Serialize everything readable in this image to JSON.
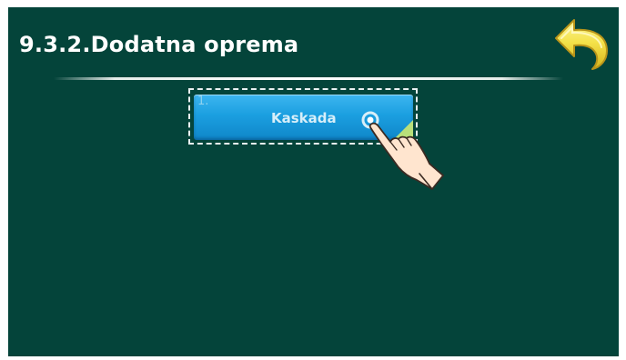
{
  "header": {
    "title": "9.3.2.Dodatna oprema"
  },
  "navigation": {
    "back_icon": "back-arrow-icon"
  },
  "menu": {
    "items": [
      {
        "index": "1.",
        "label": "Kaskada",
        "corner_color": "#b9e07a"
      }
    ]
  },
  "overlay": {
    "pointer_icon": "pointing-hand-icon"
  },
  "colors": {
    "screen_background": "#04443a",
    "tile_blue": "#1b9fe0",
    "back_arrow_yellow": "#f4e24a"
  }
}
